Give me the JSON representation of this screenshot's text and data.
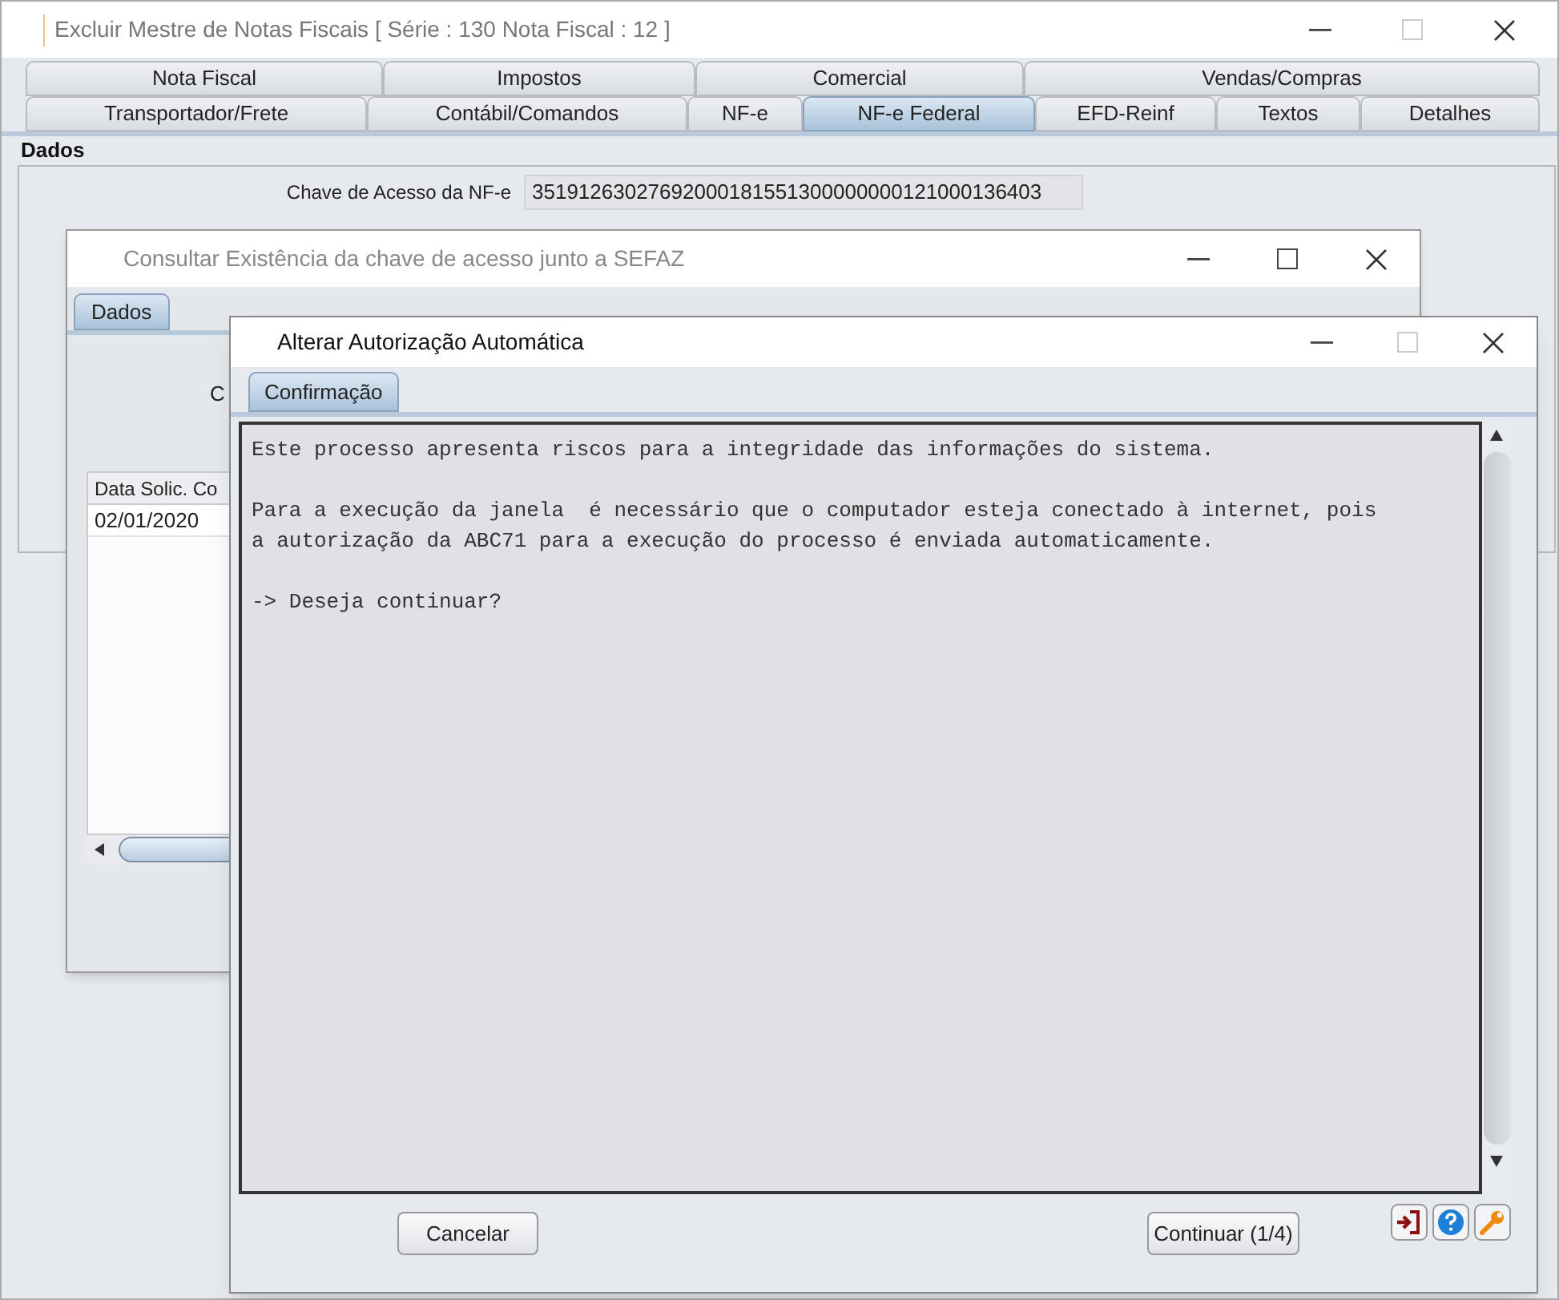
{
  "main_window": {
    "title": "Excluir Mestre de Notas Fiscais [ Série : 130 Nota Fiscal : 12 ]",
    "tab_rows": [
      [
        {
          "label": "Nota Fiscal",
          "selected": false
        },
        {
          "label": "Impostos",
          "selected": false
        },
        {
          "label": "Comercial",
          "selected": false
        },
        {
          "label": "Vendas/Compras",
          "selected": false
        }
      ],
      [
        {
          "label": "Transportador/Frete",
          "selected": false
        },
        {
          "label": "Contábil/Comandos",
          "selected": false
        },
        {
          "label": "NF-e",
          "selected": false
        },
        {
          "label": "NF-e Federal",
          "selected": true
        },
        {
          "label": "EFD-Reinf",
          "selected": false
        },
        {
          "label": "Textos",
          "selected": false
        },
        {
          "label": "Detalhes",
          "selected": false
        }
      ]
    ],
    "group": {
      "title": "Dados",
      "fields": [
        {
          "label": "Chave de Acesso da NF-e",
          "value": "35191263027692000181551300000000121000136403"
        }
      ]
    }
  },
  "query_window": {
    "title": "Consultar Existência da chave de acesso junto a SEFAZ",
    "tabs": [
      {
        "label": "Dados",
        "selected": true
      }
    ],
    "partial_label": "C",
    "table": {
      "columns": [
        "Data Solic. Co"
      ],
      "rows": [
        [
          "02/01/2020"
        ]
      ]
    }
  },
  "dialog": {
    "title": "Alterar Autorização Automática",
    "tabs": [
      {
        "label": "Confirmação",
        "selected": true
      }
    ],
    "message": [
      "Este processo apresenta riscos para a integridade das informações do sistema.",
      "Para a execução da janela  é necessário que o computador esteja conectado à internet, pois\na autorização da ABC71 para a execução do processo é enviada automaticamente.",
      "-> Deseja continuar?"
    ],
    "buttons": [
      {
        "label": "Cancelar"
      },
      {
        "label": "Continuar (1/4)"
      }
    ]
  }
}
